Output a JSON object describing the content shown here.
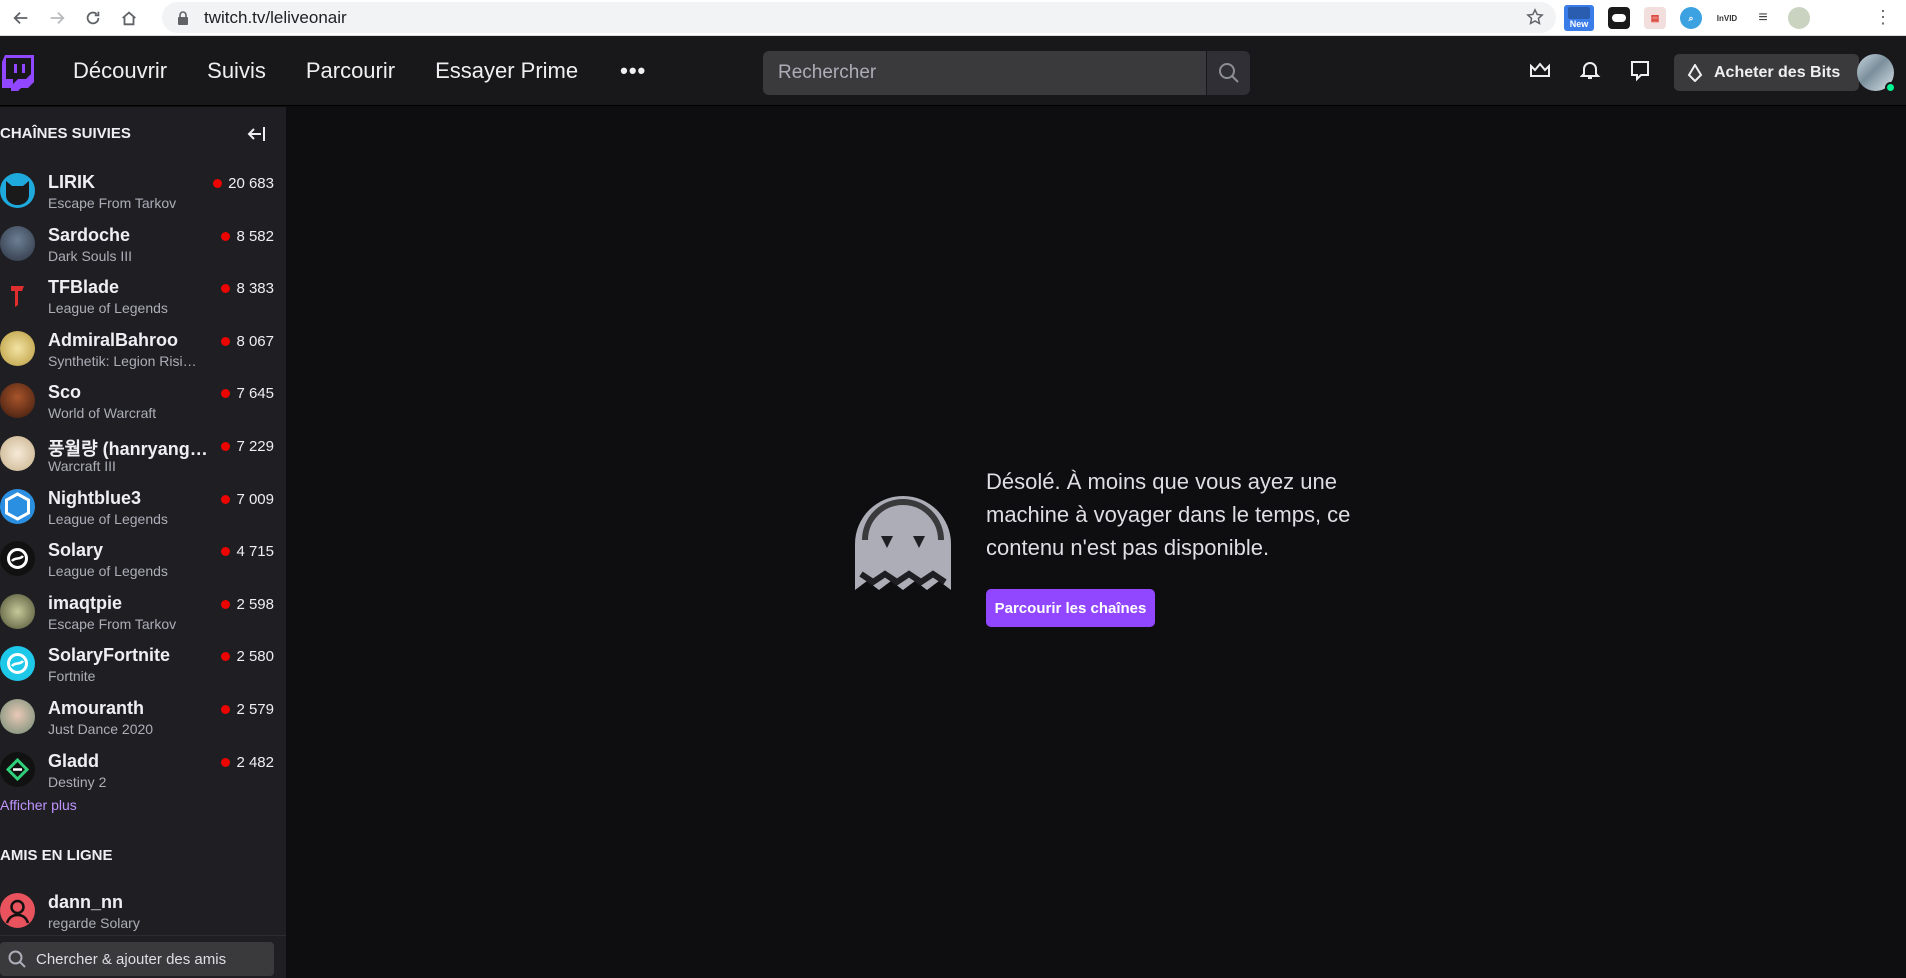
{
  "browser": {
    "url": "twitch.tv/leliveonair",
    "extensions": [
      {
        "icon": "new-badge-extension-icon",
        "label": "New"
      },
      {
        "icon": "mask-extension-icon",
        "label": ""
      },
      {
        "icon": "pdf-extension-icon",
        "label": ""
      },
      {
        "icon": "magnifier-extension-icon",
        "label": ""
      },
      {
        "icon": "invid-extension-icon",
        "label": "InVID"
      },
      {
        "icon": "playlist-extension-icon",
        "label": ""
      },
      {
        "icon": "profile-extension-icon",
        "label": ""
      }
    ]
  },
  "topnav": {
    "links": [
      "Découvrir",
      "Suivis",
      "Parcourir",
      "Essayer Prime"
    ],
    "more": "•••",
    "search_placeholder": "Rechercher",
    "bits_label": "Acheter des Bits"
  },
  "sidebar": {
    "followed_header": "CHAÎNES SUIVIES",
    "channels": [
      {
        "name": "LIRIK",
        "game": "Escape From Tarkov",
        "viewers": "20 683"
      },
      {
        "name": "Sardoche",
        "game": "Dark Souls III",
        "viewers": "8 582"
      },
      {
        "name": "TFBlade",
        "game": "League of Legends",
        "viewers": "8 383"
      },
      {
        "name": "AdmiralBahroo",
        "game": "Synthetik: Legion Risi…",
        "viewers": "8 067"
      },
      {
        "name": "Sco",
        "game": "World of Warcraft",
        "viewers": "7 645"
      },
      {
        "name": "풍월량 (hanryang11…",
        "game": "Warcraft III",
        "viewers": "7 229"
      },
      {
        "name": "Nightblue3",
        "game": "League of Legends",
        "viewers": "7 009"
      },
      {
        "name": "Solary",
        "game": "League of Legends",
        "viewers": "4 715"
      },
      {
        "name": "imaqtpie",
        "game": "Escape From Tarkov",
        "viewers": "2 598"
      },
      {
        "name": "SolaryFortnite",
        "game": "Fortnite",
        "viewers": "2 580"
      },
      {
        "name": "Amouranth",
        "game": "Just Dance 2020",
        "viewers": "2 579"
      },
      {
        "name": "Gladd",
        "game": "Destiny 2",
        "viewers": "2 482"
      }
    ],
    "show_more": "Afficher plus",
    "friends_header": "AMIS EN LIGNE",
    "friend": {
      "name": "dann_nn",
      "status": "regarde Solary"
    },
    "friend_search_placeholder": "Chercher & ajouter des amis"
  },
  "main": {
    "message": "Désolé. À moins que vous ayez une machine à voyager dans le temps, ce contenu n'est pas disponible.",
    "browse_button": "Parcourir les chaînes"
  },
  "colors": {
    "accent": "#9147ff",
    "live": "#eb0400",
    "link": "#bf94ff",
    "background": "#0e0e10",
    "sidebar": "#1f1f23",
    "topnav": "#18181b"
  }
}
